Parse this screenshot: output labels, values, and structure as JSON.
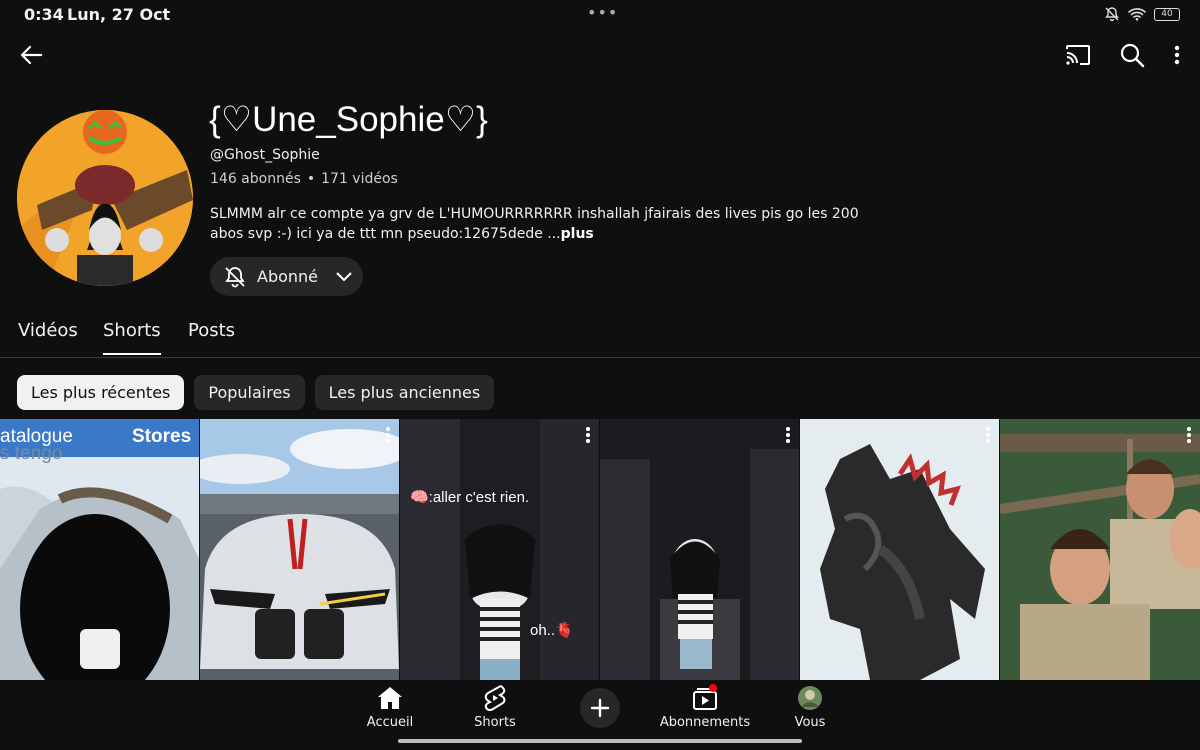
{
  "status_bar": {
    "time": "0:34",
    "date": "Lun, 27 Oct",
    "battery": "40"
  },
  "channel": {
    "name": "{♡Une_Sophie♡}",
    "handle": "@Ghost_Sophie",
    "subscribers": "146 abonnés",
    "separator": "•",
    "videos": "171 vidéos",
    "description": "SLMMM alr ce compte ya grv de L'HUMOURRRRRRR inshallah jfairais des lives pis go les 200 abos svp :-) ici ya de ttt mn pseudo:12675dede ...",
    "more": "plus",
    "subscribe_label": "Abonné"
  },
  "tabs": [
    {
      "label": "Vidéos"
    },
    {
      "label": "Shorts"
    },
    {
      "label": "Posts"
    }
  ],
  "active_tab": "Shorts",
  "chips": [
    {
      "label": "Les plus récentes"
    },
    {
      "label": "Populaires"
    },
    {
      "label": "Les plus anciennes"
    }
  ],
  "shorts": [
    {
      "overlay_1": "atalogue",
      "overlay_2": "Stores",
      "overlay_3": "s tengo"
    },
    {
      "overlay_1": ""
    },
    {
      "overlay_1": "🧠:aller c'est rien.",
      "overlay_2": "oh..🫀"
    },
    {
      "overlay_1": ""
    },
    {
      "overlay_1": ""
    },
    {
      "overlay_1": ""
    }
  ],
  "bottom_nav": {
    "home": "Accueil",
    "shorts": "Shorts",
    "subscriptions": "Abonnements",
    "you": "Vous"
  },
  "colors": {
    "background": "#0f0f0f",
    "chip": "#272727",
    "chip_active": "#f1f1f1",
    "notification": "#ff0000"
  }
}
